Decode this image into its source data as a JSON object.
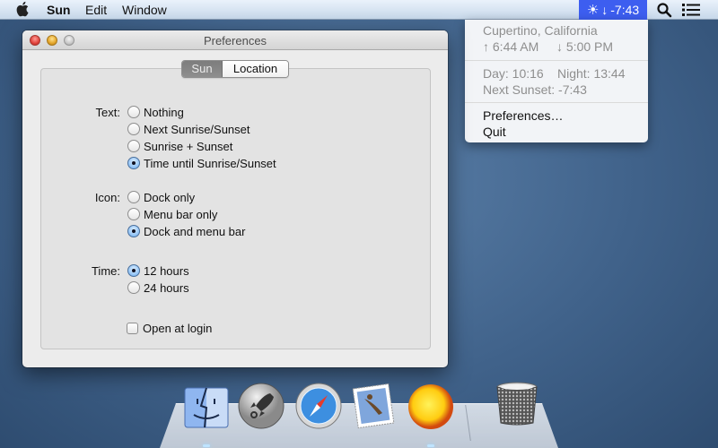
{
  "menubar": {
    "apple_icon": "apple-logo-icon",
    "app_name": "Sun",
    "menus": [
      "Edit",
      "Window"
    ],
    "status_item": {
      "icon": "sun-icon",
      "arrow": "↓",
      "text": "-7:43",
      "highlight_color": "#3d5ef0"
    },
    "spotlight_icon": "search-icon",
    "notification_icon": "list-icon"
  },
  "dropdown": {
    "location": "Cupertino, California",
    "sunrise": "↑ 6:44 AM",
    "sunset": "↓ 5:00 PM",
    "day": "Day: 10:16",
    "night": "Night: 13:44",
    "next_sunset": "Next Sunset: -7:43",
    "items": [
      "Preferences…",
      "Quit"
    ]
  },
  "window": {
    "title": "Preferences",
    "tabs": [
      {
        "label": "Sun",
        "active": true
      },
      {
        "label": "Location",
        "active": false
      }
    ],
    "groups": [
      {
        "label": "Text:",
        "options": [
          {
            "label": "Nothing",
            "selected": false
          },
          {
            "label": "Next Sunrise/Sunset",
            "selected": false
          },
          {
            "label": "Sunrise + Sunset",
            "selected": false
          },
          {
            "label": "Time until Sunrise/Sunset",
            "selected": true
          }
        ]
      },
      {
        "label": "Icon:",
        "options": [
          {
            "label": "Dock only",
            "selected": false
          },
          {
            "label": "Menu bar only",
            "selected": false
          },
          {
            "label": "Dock and menu bar",
            "selected": true
          }
        ]
      },
      {
        "label": "Time:",
        "options": [
          {
            "label": "12 hours",
            "selected": true
          },
          {
            "label": "24 hours",
            "selected": false
          }
        ]
      }
    ],
    "open_at_login": {
      "label": "Open at login",
      "checked": false
    }
  },
  "dock": {
    "apps": [
      {
        "name": "Finder",
        "icon": "finder-icon",
        "running": true
      },
      {
        "name": "Launchpad",
        "icon": "launchpad-rocket-icon",
        "running": false
      },
      {
        "name": "Safari",
        "icon": "safari-compass-icon",
        "running": false
      },
      {
        "name": "Mail",
        "icon": "mail-stamp-icon",
        "running": false
      },
      {
        "name": "Sun",
        "icon": "sun-icon",
        "running": true
      }
    ],
    "trash": {
      "name": "Trash",
      "icon": "trash-icon"
    }
  }
}
